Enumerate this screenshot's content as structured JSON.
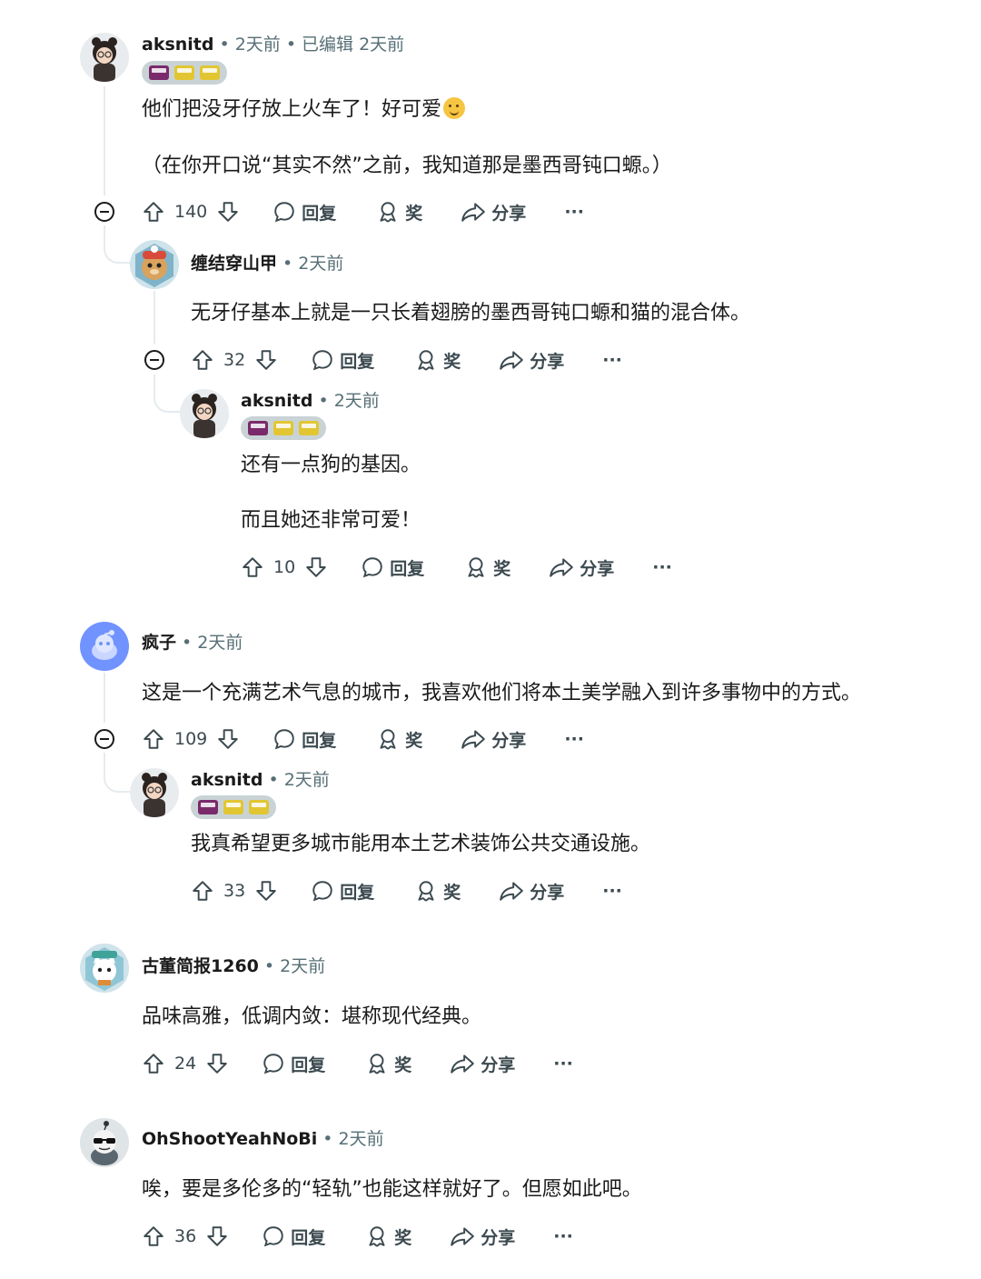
{
  "comments": [
    {
      "user": "aksnitd",
      "time": "2天前",
      "edited": "已编辑 2天前",
      "lines": [
        "他们把没牙仔放上火车了！好可爱",
        "（在你开口说“其实不然”之前，我知道那是墨西哥钝口螈。）"
      ],
      "votes": "140"
    },
    {
      "user": "缠结穿山甲",
      "time": "2天前",
      "lines": [
        "无牙仔基本上就是一只长着翅膀的墨西哥钝口螈和猫的混合体。"
      ],
      "votes": "32"
    },
    {
      "user": "aksnitd",
      "time": "2天前",
      "lines": [
        "还有一点狗的基因。",
        "而且她还非常可爱！"
      ],
      "votes": "10"
    },
    {
      "user": "疯子",
      "time": "2天前",
      "lines": [
        "这是一个充满艺术气息的城市，我喜欢他们将本土美学融入到许多事物中的方式。"
      ],
      "votes": "109"
    },
    {
      "user": "aksnitd",
      "time": "2天前",
      "lines": [
        "我真希望更多城市能用本土艺术装饰公共交通设施。"
      ],
      "votes": "33"
    },
    {
      "user": "古董简报1260",
      "time": "2天前",
      "lines": [
        "品味高雅，低调内敛：堪称现代经典。"
      ],
      "votes": "24"
    },
    {
      "user": "OhShootYeahNoBi",
      "time": "2天前",
      "lines": [
        "唉，要是多伦多的“轻轨”也能这样就好了。但愿如此吧。"
      ],
      "votes": "36"
    }
  ],
  "labels": {
    "reply": "回复",
    "award": "奖",
    "share": "分享",
    "more": "···"
  },
  "colors": {
    "meta": "#576f76",
    "text": "#1a1a1b",
    "action": "#3c4a50",
    "flair": "#c9d3d6",
    "default_avatar": "#7193ff"
  }
}
